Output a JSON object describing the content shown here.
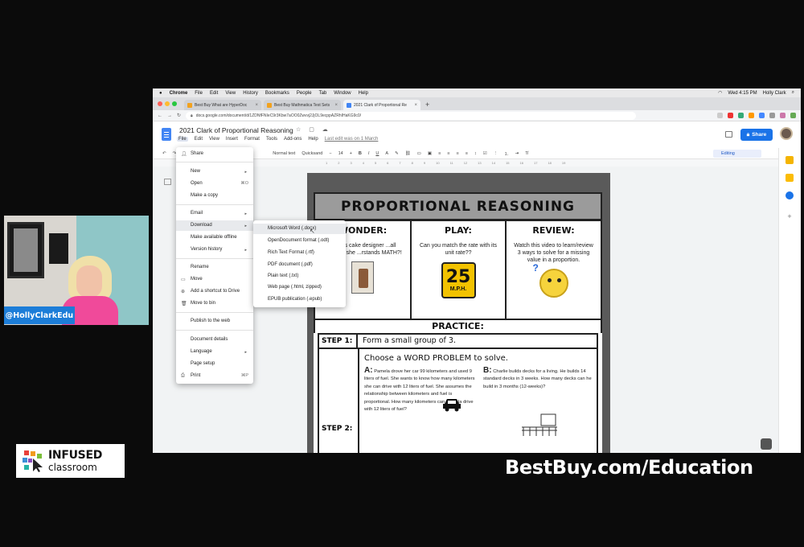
{
  "mac_menubar": {
    "app": "Chrome",
    "items": [
      "File",
      "Edit",
      "View",
      "History",
      "Bookmarks",
      "People",
      "Tab",
      "Window",
      "Help"
    ],
    "clock": "Wed 4:15 PM",
    "user": "Holly Clark"
  },
  "tabs": [
    {
      "label": "Best Buy What are HyperDoc",
      "active": false
    },
    {
      "label": "Best Buy Mathmatica Test Sets",
      "active": false
    },
    {
      "label": "2021 Clark of Proportional Re",
      "active": true
    }
  ],
  "address": {
    "url": "docs.google.com/document/d/1ZDNfFNIeC9r3Kbw7aOO0Zwvvj2JjOL9ecppAZRhIHaKG9c0/"
  },
  "docs": {
    "title": "2021 Clark of Proportional Reasoning",
    "menu": [
      "File",
      "Edit",
      "View",
      "Insert",
      "Format",
      "Tools",
      "Add-ons",
      "Help"
    ],
    "last_edit": "Last edit was on 1 March",
    "share": "Share",
    "editing": "Editing",
    "toolbar": {
      "style": "Normal text",
      "font": "Quicksand",
      "size": "14"
    }
  },
  "file_menu": {
    "items": [
      {
        "label": "Share"
      },
      {
        "label": "New",
        "arrow": true
      },
      {
        "label": "Open",
        "shortcut": "⌘O"
      },
      {
        "label": "Make a copy"
      },
      {
        "label": "Email",
        "arrow": true
      },
      {
        "label": "Download",
        "arrow": true,
        "highlight": true
      },
      {
        "label": "Make available offline"
      },
      {
        "label": "Version history",
        "arrow": true
      },
      {
        "label": "Rename"
      },
      {
        "label": "Move"
      },
      {
        "label": "Add a shortcut to Drive"
      },
      {
        "label": "Move to bin"
      },
      {
        "label": "Publish to the web"
      },
      {
        "label": "Document details"
      },
      {
        "label": "Language",
        "arrow": true
      },
      {
        "label": "Page setup"
      },
      {
        "label": "Print",
        "shortcut": "⌘P"
      }
    ]
  },
  "download_menu": {
    "items": [
      {
        "label": "Microsoft Word (.docx)",
        "highlight": true
      },
      {
        "label": "OpenDocument format (.odt)"
      },
      {
        "label": "Rich Text Format (.rtf)"
      },
      {
        "label": "PDF document (.pdf)"
      },
      {
        "label": "Plain text (.txt)"
      },
      {
        "label": "Web page (.html, zipped)"
      },
      {
        "label": "EPUB publication (.epub)"
      }
    ]
  },
  "worksheet": {
    "title": "PROPORTIONAL REASONING",
    "wonder": {
      "heading": "WONDER:",
      "text": "...n this cake designer ...all because she ...rstands MATH?!"
    },
    "play": {
      "heading": "PLAY:",
      "text": "Can you match the rate with its unit rate??",
      "sign_number": "25",
      "sign_unit": "M.P.H."
    },
    "review": {
      "heading": "REVIEW:",
      "text": "Watch this video to learn/review 3 ways to solve for a missing value in a proportion."
    },
    "practice": "PRACTICE:",
    "step1": {
      "label": "STEP 1:",
      "text": "Form a small group of 3."
    },
    "step2": {
      "label": "STEP 2:",
      "choose": "Choose a WORD PROBLEM to solve."
    },
    "problem_a": {
      "letter": "A:",
      "text": "Pamela drove her car 99 kilometers and used 9 liters of fuel. She wants to know how many kilometers she can drive with 12 liters of fuel. She assumes the relationship between kilometers and fuel is proportional. How many kilometers can Pamela drive with 12 liters of fuel?"
    },
    "problem_b": {
      "letter": "B:",
      "text": "Charlie builds decks for a living. He builds 14 standard decks in 3 weeks. How many decks can he build in 3 months (12-weeks)?"
    }
  },
  "overlay": {
    "handle": "@HollyClarkEdu",
    "logo_line1": "INFUSED",
    "logo_line2": "classroom",
    "url": "BestBuy.com/Education"
  }
}
